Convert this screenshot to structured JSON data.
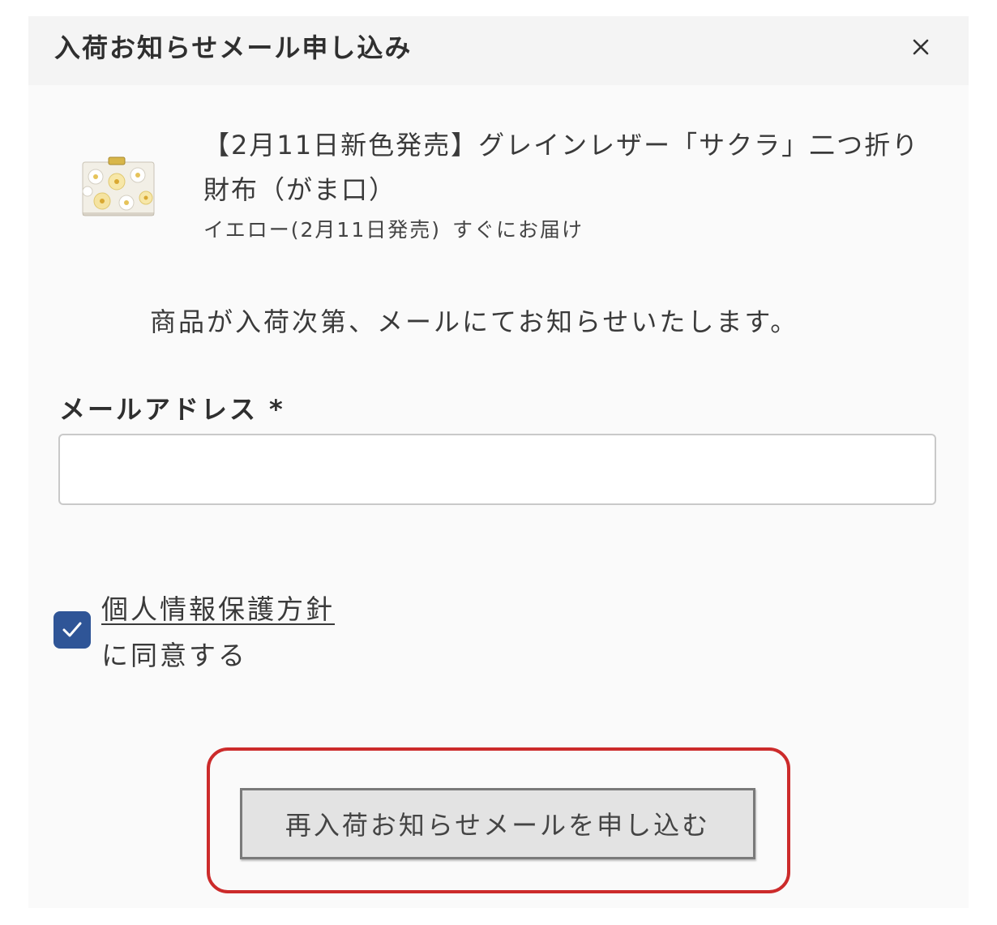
{
  "modal": {
    "title": "入荷お知らせメール申し込み",
    "close_label": "×"
  },
  "product": {
    "name": "【2月11日新色発売】グレインレザー「サクラ」二つ折り財布（がま口）",
    "variant": "イエロー(2月11日発売)",
    "delivery": "すぐにお届け",
    "image_icon": "wallet-thumbnail"
  },
  "notice": "商品が入荷次第、メールにてお知らせいたします。",
  "email": {
    "label": "メールアドレス",
    "required_mark": "*",
    "value": "",
    "placeholder": ""
  },
  "agreement": {
    "checked": true,
    "policy_link": "個人情報保護方針",
    "suffix": "に同意する"
  },
  "submit": {
    "label": "再入荷お知らせメールを申し込む"
  },
  "colors": {
    "checkbox": "#2f5597",
    "highlight": "#cc2b2b",
    "button_bg": "#e3e3e3"
  }
}
